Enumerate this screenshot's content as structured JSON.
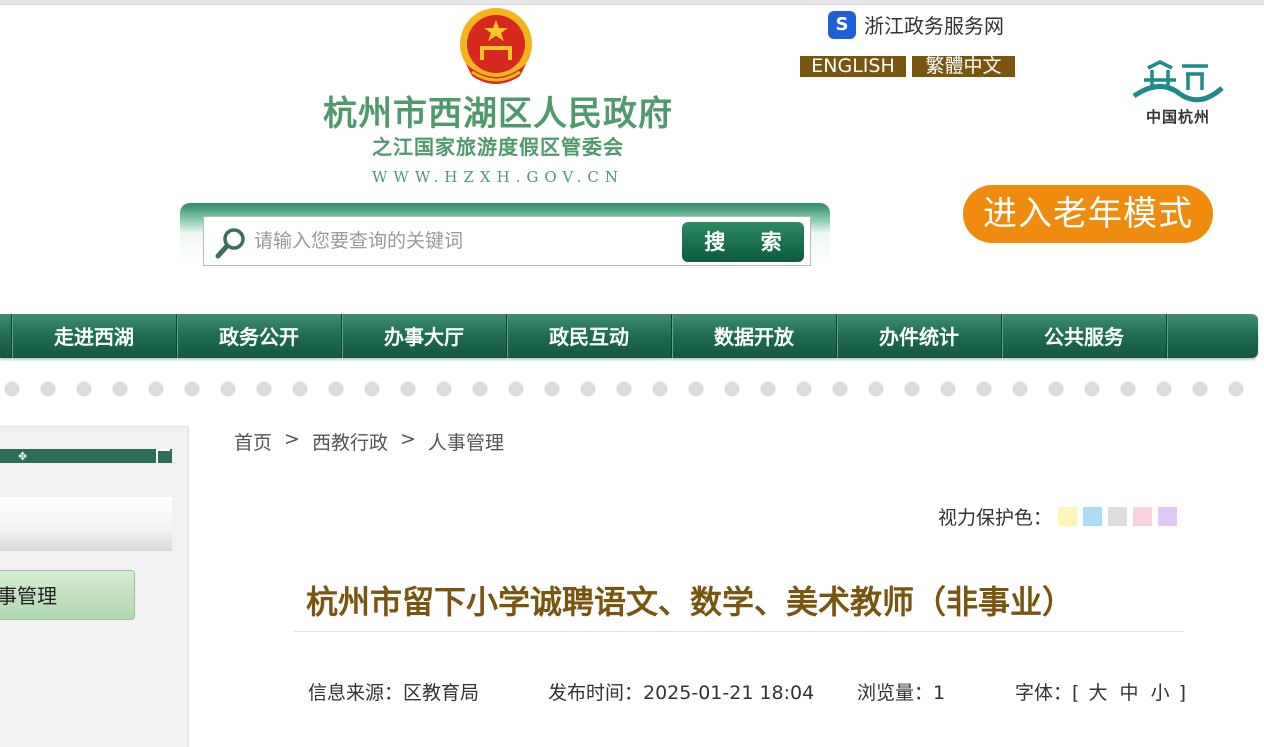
{
  "header": {
    "site_title": "杭州市西湖区人民政府",
    "site_subtitle": "之江国家旅游度假区管委会",
    "site_url": "WWW.HZXH.GOV.CN",
    "zj_link": "浙江政务服务网",
    "lang_en": "ENGLISH",
    "lang_tw": "繁體中文",
    "hz_logo_text": "中国杭州",
    "elder_mode": "进入老年模式"
  },
  "search": {
    "placeholder": "请输入您要查询的关键词",
    "button": "搜 索"
  },
  "nav": {
    "items": [
      "走进西湖",
      "政务公开",
      "办事大厅",
      "政民互动",
      "数据开放",
      "办件统计",
      "公共服务"
    ]
  },
  "sidebar": {
    "active_item": "事管理"
  },
  "breadcrumb": {
    "items": [
      "首页",
      "西教行政",
      "人事管理"
    ],
    "separator": ">"
  },
  "eye_care": {
    "label": "视力保护色：",
    "colors": [
      "#fdf6b6",
      "#a9dcf5",
      "#dddddd",
      "#fbd0df",
      "#e2c8f6"
    ]
  },
  "article": {
    "title": "杭州市留下小学诚聘语文、数学、美术教师（非事业）",
    "source": "信息来源：区教育局",
    "time": "发布时间：2025-01-21 18:04",
    "views": "浏览量：1",
    "font_label": "字体：[",
    "font_large": "大",
    "font_medium": "中",
    "font_small": "小",
    "font_close": "]"
  },
  "colors": {
    "brand_green": "#1e6b50",
    "title_brown": "#7a5510",
    "elder_orange": "#ef8b0e"
  }
}
